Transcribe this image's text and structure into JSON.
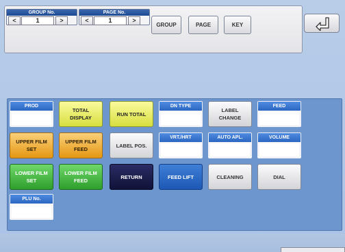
{
  "top": {
    "group": {
      "header": "GROUP No.",
      "value": "1",
      "prev": "<",
      "next": ">"
    },
    "page": {
      "header": "PAGE No.",
      "value": "1",
      "prev": "<",
      "next": ">"
    },
    "buttons": {
      "group": "GROUP",
      "page": "PAGE",
      "key": "KEY"
    }
  },
  "back_icon": "return-arrow-icon",
  "keys": {
    "prod": "PROD",
    "total_display": "TOTAL DISPLAY",
    "run_total": "RUN TOTAL",
    "dn_type": "DN TYPE",
    "label_change": "LABEL CHANGE",
    "feed": "FEED",
    "upper_film_set": "UPPER FILM SET",
    "upper_film_feed": "UPPER FILM FEED",
    "label_pos": "LABEL POS.",
    "vrt_hrt": "VRT./HRT",
    "auto_apl": "AUTO APL.",
    "volume": "VOLUME",
    "lower_film_set": "LOWER FILM SET",
    "lower_film_feed": "LOWER FILM FEED",
    "return": "RETURN",
    "feed_lift": "FEED LIFT",
    "cleaning": "CLEANING",
    "dial": "DIAL",
    "plu_no": "PLU No."
  },
  "colors": {
    "panel": "#6d96cf",
    "header_blue": "#2b66c2",
    "yellow": "#e8ec6c",
    "orange": "#f2b43e",
    "green": "#46b844",
    "navy": "#16184a",
    "blue": "#2a6cc8"
  }
}
